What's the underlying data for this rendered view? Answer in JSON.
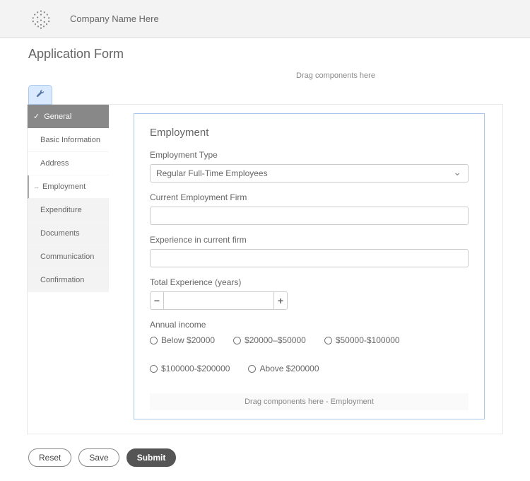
{
  "header": {
    "company_name": "Company Name Here"
  },
  "page": {
    "title": "Application Form",
    "drag_hint": "Drag components here"
  },
  "sidebar": {
    "items": [
      {
        "label": "General",
        "state": "done"
      },
      {
        "label": "Basic Information",
        "state": "sub"
      },
      {
        "label": "Address",
        "state": "sub"
      },
      {
        "label": "Employment",
        "state": "current"
      },
      {
        "label": "Expenditure",
        "state": "shaded"
      },
      {
        "label": "Documents",
        "state": "shaded"
      },
      {
        "label": "Communication",
        "state": "shaded"
      },
      {
        "label": "Confirmation",
        "state": "shaded"
      }
    ]
  },
  "form": {
    "section_title": "Employment",
    "employment_type": {
      "label": "Employment Type",
      "selected": "Regular Full-Time Employees"
    },
    "employment_firm": {
      "label": "Current Employment Firm",
      "value": ""
    },
    "experience_current": {
      "label": "Experience in current firm",
      "value": ""
    },
    "total_experience": {
      "label": "Total Experience (years)",
      "value": ""
    },
    "annual_income": {
      "label": "Annual income",
      "options": [
        "Below $20000",
        "$20000–$50000",
        "$50000-$100000",
        "$100000-$200000",
        "Above $200000"
      ]
    },
    "drag_hint": "Drag components here - Employment"
  },
  "footer": {
    "reset": "Reset",
    "save": "Save",
    "submit": "Submit"
  }
}
